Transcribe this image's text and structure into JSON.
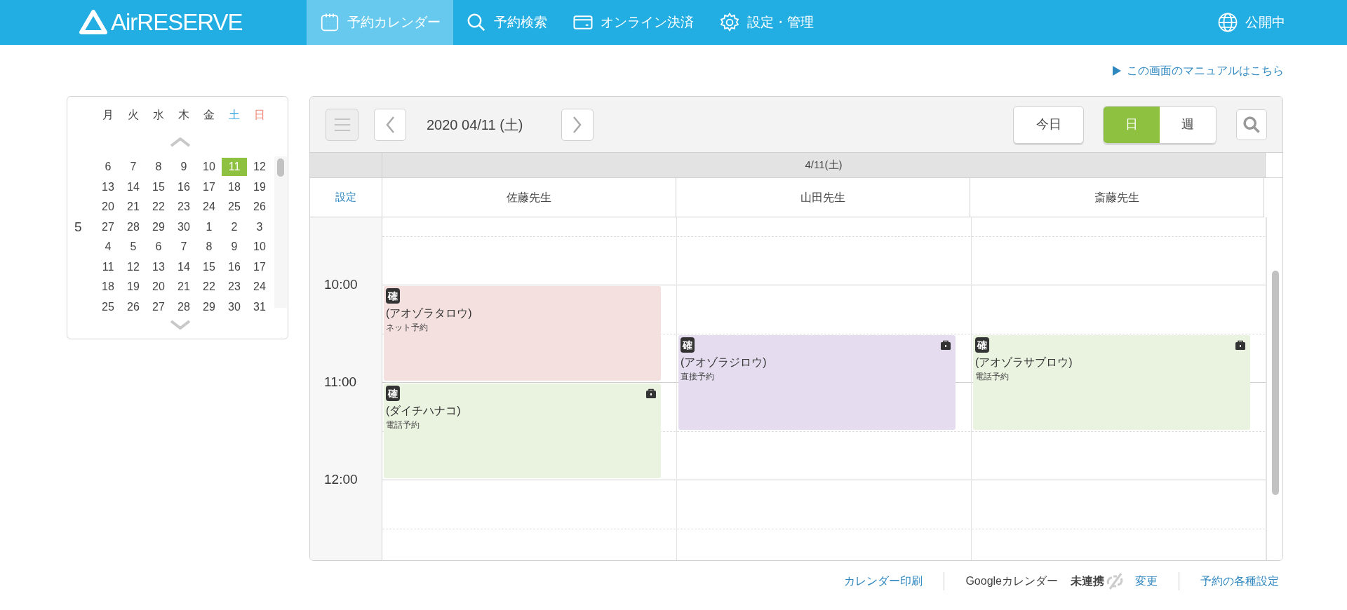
{
  "header": {
    "logo": "AirRESERVE",
    "nav": [
      {
        "label": "予約カレンダー",
        "selected": true
      },
      {
        "label": "予約検索",
        "selected": false
      },
      {
        "label": "オンライン決済",
        "selected": false
      },
      {
        "label": "設定・管理",
        "selected": false
      }
    ],
    "status": "公開中"
  },
  "manual_link": "この画面のマニュアルはこちら",
  "mini_calendar": {
    "weekdays": [
      {
        "label": "月",
        "kind": "weekday"
      },
      {
        "label": "火",
        "kind": "weekday"
      },
      {
        "label": "水",
        "kind": "weekday"
      },
      {
        "label": "木",
        "kind": "weekday"
      },
      {
        "label": "金",
        "kind": "weekday"
      },
      {
        "label": "土",
        "kind": "saturday"
      },
      {
        "label": "日",
        "kind": "sunday"
      }
    ],
    "weeks": [
      {
        "days": [
          {
            "day": "6",
            "selected": false
          },
          {
            "day": "7",
            "selected": false
          },
          {
            "day": "8",
            "selected": false
          },
          {
            "day": "9",
            "selected": false
          },
          {
            "day": "10",
            "selected": false
          },
          {
            "day": "11",
            "selected": true
          },
          {
            "day": "12",
            "selected": false
          }
        ]
      },
      {
        "days": [
          {
            "day": "13",
            "selected": false
          },
          {
            "day": "14",
            "selected": false
          },
          {
            "day": "15",
            "selected": false
          },
          {
            "day": "16",
            "selected": false
          },
          {
            "day": "17",
            "selected": false
          },
          {
            "day": "18",
            "selected": false
          },
          {
            "day": "19",
            "selected": false
          }
        ]
      },
      {
        "days": [
          {
            "day": "20",
            "selected": false
          },
          {
            "day": "21",
            "selected": false
          },
          {
            "day": "22",
            "selected": false
          },
          {
            "day": "23",
            "selected": false
          },
          {
            "day": "24",
            "selected": false
          },
          {
            "day": "25",
            "selected": false
          },
          {
            "day": "26",
            "selected": false
          }
        ]
      },
      {
        "month": "5",
        "days": [
          {
            "day": "27",
            "selected": false
          },
          {
            "day": "28",
            "selected": false
          },
          {
            "day": "29",
            "selected": false
          },
          {
            "day": "30",
            "selected": false
          },
          {
            "day": "1",
            "selected": false
          },
          {
            "day": "2",
            "selected": false
          },
          {
            "day": "3",
            "selected": false
          }
        ]
      },
      {
        "days": [
          {
            "day": "4",
            "selected": false
          },
          {
            "day": "5",
            "selected": false
          },
          {
            "day": "6",
            "selected": false
          },
          {
            "day": "7",
            "selected": false
          },
          {
            "day": "8",
            "selected": false
          },
          {
            "day": "9",
            "selected": false
          },
          {
            "day": "10",
            "selected": false
          }
        ]
      },
      {
        "days": [
          {
            "day": "11",
            "selected": false
          },
          {
            "day": "12",
            "selected": false
          },
          {
            "day": "13",
            "selected": false
          },
          {
            "day": "14",
            "selected": false
          },
          {
            "day": "15",
            "selected": false
          },
          {
            "day": "16",
            "selected": false
          },
          {
            "day": "17",
            "selected": false
          }
        ]
      },
      {
        "days": [
          {
            "day": "18",
            "selected": false
          },
          {
            "day": "19",
            "selected": false
          },
          {
            "day": "20",
            "selected": false
          },
          {
            "day": "21",
            "selected": false
          },
          {
            "day": "22",
            "selected": false
          },
          {
            "day": "23",
            "selected": false
          },
          {
            "day": "24",
            "selected": false
          }
        ]
      },
      {
        "days": [
          {
            "day": "25",
            "selected": false
          },
          {
            "day": "26",
            "selected": false
          },
          {
            "day": "27",
            "selected": false
          },
          {
            "day": "28",
            "selected": false
          },
          {
            "day": "29",
            "selected": false
          },
          {
            "day": "30",
            "selected": false
          },
          {
            "day": "31",
            "selected": false
          }
        ]
      }
    ]
  },
  "toolbar": {
    "date": "2020 04/11 (土)",
    "today_button": "今日",
    "views": [
      {
        "label": "日",
        "selected": true
      },
      {
        "label": "週",
        "selected": false
      }
    ]
  },
  "schedule": {
    "date_header": "4/11(土)",
    "settings_link": "設定",
    "time_labels": [
      "10:00",
      "11:00",
      "12:00"
    ],
    "columns": [
      {
        "name": "佐藤先生",
        "events": [
          {
            "status": "確",
            "name": "(アオゾラタロウ)",
            "source": "ネット予約",
            "color": "#f5e0e0",
            "locked": false
          },
          {
            "status": "確",
            "name": "(ダイチハナコ)",
            "source": "電話予約",
            "color": "#eaf3e0",
            "locked": true
          }
        ]
      },
      {
        "name": "山田先生",
        "events": [
          {
            "status": "確",
            "name": "(アオゾラジロウ)",
            "source": "直接予約",
            "color": "#e5ddef",
            "locked": true
          }
        ]
      },
      {
        "name": "斎藤先生",
        "events": [
          {
            "status": "確",
            "name": "(アオゾラサブロウ)",
            "source": "電話予約",
            "color": "#eaf3e0",
            "locked": true
          }
        ]
      }
    ]
  },
  "footer": {
    "print_link": "カレンダー印刷",
    "google_label": "Googleカレンダー",
    "google_status": "未連携",
    "google_linked": false,
    "change_link": "変更",
    "settings_link": "予約の各種設定"
  }
}
